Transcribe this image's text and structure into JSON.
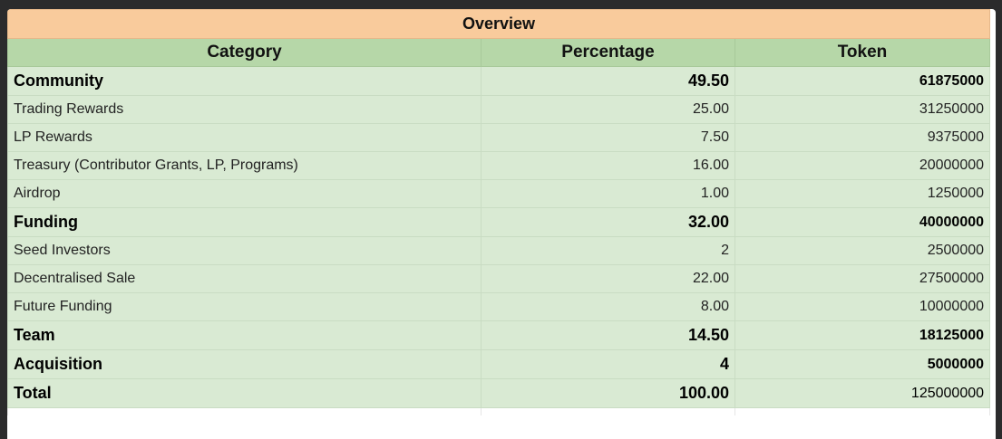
{
  "overview": {
    "title": "Overview",
    "headers": [
      "Category",
      "Percentage",
      "Token"
    ],
    "rows": [
      {
        "category": "Community",
        "percentage": "49.50",
        "token": "61875000",
        "bold": true
      },
      {
        "category": "Trading Rewards",
        "percentage": "25.00",
        "token": "31250000",
        "bold": false
      },
      {
        "category": "LP Rewards",
        "percentage": "7.50",
        "token": "9375000",
        "bold": false
      },
      {
        "category": "Treasury (Contributor Grants, LP, Programs)",
        "percentage": "16.00",
        "token": "20000000",
        "bold": false
      },
      {
        "category": "Airdrop",
        "percentage": "1.00",
        "token": "1250000",
        "bold": false
      },
      {
        "category": "Funding",
        "percentage": "32.00",
        "token": "40000000",
        "bold": true
      },
      {
        "category": "Seed Investors",
        "percentage": "2",
        "token": "2500000",
        "bold": false
      },
      {
        "category": "Decentralised Sale",
        "percentage": "22.00",
        "token": "27500000",
        "bold": false
      },
      {
        "category": "Future Funding",
        "percentage": "8.00",
        "token": "10000000",
        "bold": false
      },
      {
        "category": "Team",
        "percentage": "14.50",
        "token": "18125000",
        "bold": true
      },
      {
        "category": "Acquisition",
        "percentage": "4",
        "token": "5000000",
        "bold": true
      },
      {
        "category": "Total",
        "percentage": "100.00",
        "token": "125000000",
        "bold": true,
        "total": true
      }
    ]
  }
}
